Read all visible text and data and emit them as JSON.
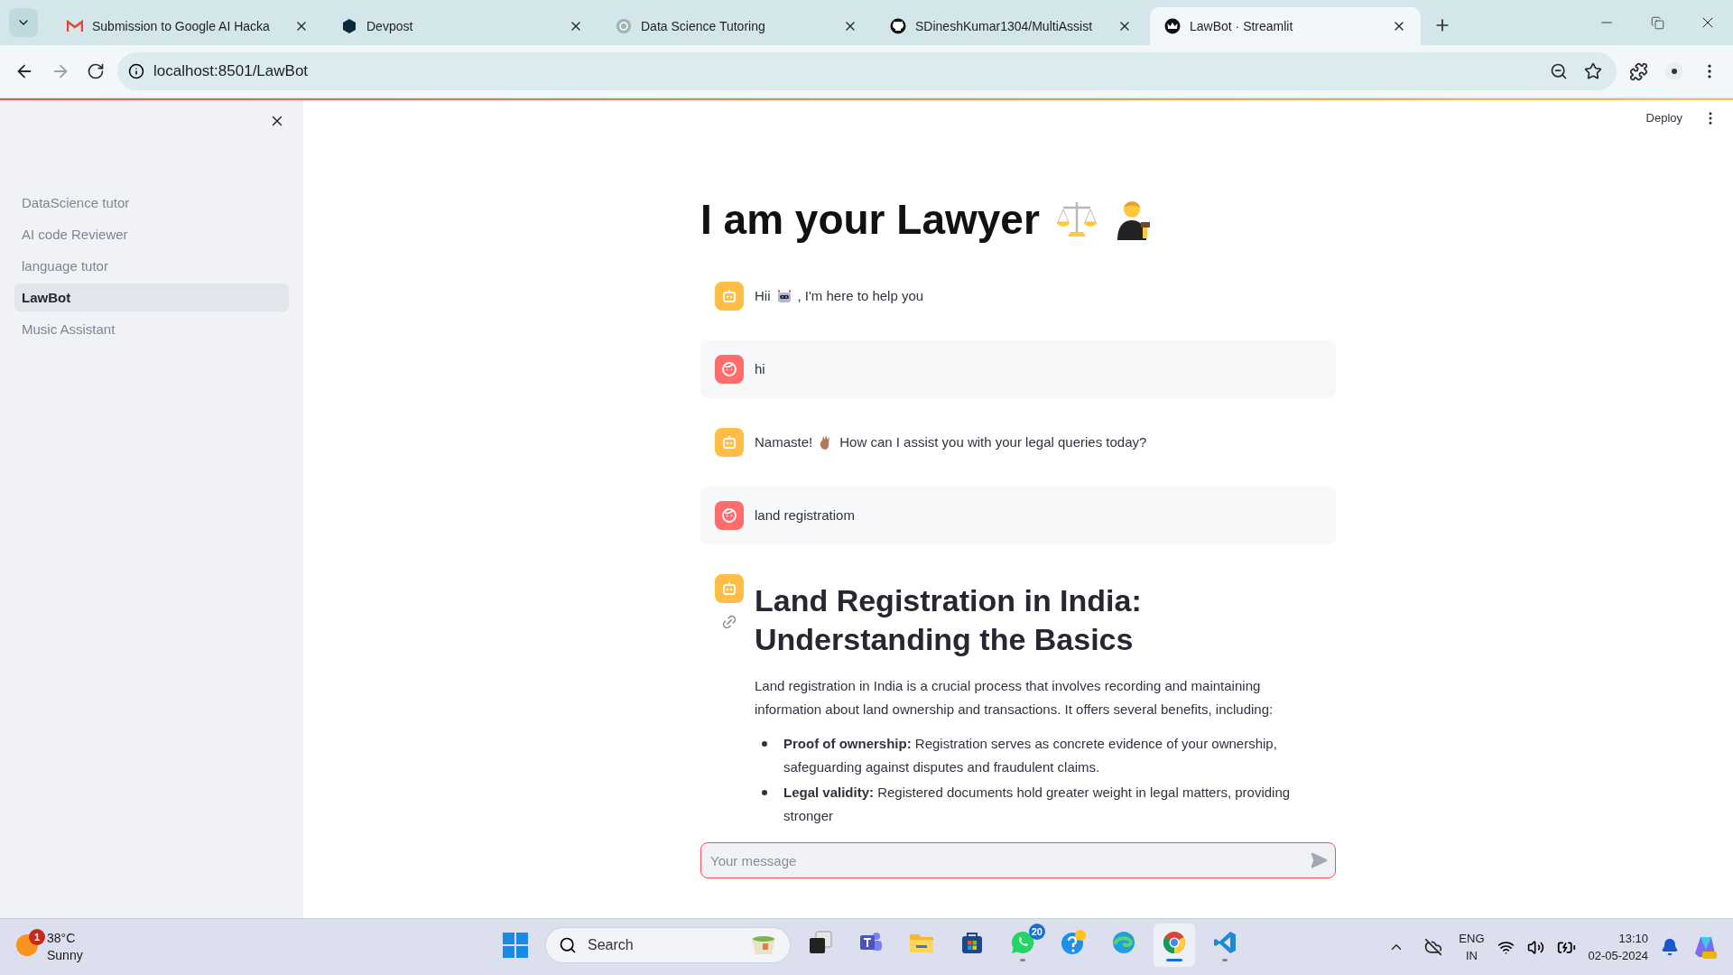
{
  "browser": {
    "tabs": [
      {
        "title": "Submission to Google AI Hacka",
        "kind": "mail",
        "selected": false
      },
      {
        "title": "Devpost",
        "kind": "hexagon",
        "selected": false
      },
      {
        "title": "Data Science Tutoring",
        "kind": "knot",
        "selected": false
      },
      {
        "title": "SDineshKumar1304/MultiAssist",
        "kind": "cat",
        "selected": false
      },
      {
        "title": "LawBot · Streamlit",
        "kind": "crown",
        "selected": true
      }
    ],
    "url": "localhost:8501/LawBot"
  },
  "header": {
    "deploy": "Deploy"
  },
  "sidebar": {
    "items": [
      {
        "label": "DataScience tutor",
        "selected": false
      },
      {
        "label": "AI code Reviewer",
        "selected": false
      },
      {
        "label": "language tutor",
        "selected": false
      },
      {
        "label": "LawBot",
        "selected": true
      },
      {
        "label": "Music Assistant",
        "selected": false
      }
    ]
  },
  "title": "I am your Lawyer",
  "messages": [
    {
      "from_user": false,
      "kind": "text",
      "parts": [
        "Hii",
        ", I'm here to help you"
      ]
    },
    {
      "from_user": true,
      "kind": "text",
      "parts": [
        "hi"
      ]
    },
    {
      "from_user": false,
      "kind": "text",
      "parts": [
        "Namaste!",
        "How can I assist you with your legal queries today?"
      ]
    },
    {
      "from_user": true,
      "kind": "text",
      "parts": [
        "land registratiom"
      ]
    },
    {
      "from_user": false,
      "kind": "article",
      "heading": "Land Registration in India: Understanding the Basics",
      "paragraph": "Land registration in India is a crucial process that involves recording and maintaining information about land ownership and transactions. It offers several benefits, including:",
      "bullets": [
        "**Proof of ownership:** Registration serves as concrete evidence of your ownership, safeguarding against disputes and fraudulent claims.",
        "**Legal validity:** Registered documents hold greater weight in legal matters, providing stronger"
      ]
    }
  ],
  "chat_input": {
    "placeholder": "Your message"
  },
  "taskbar": {
    "weather": {
      "temperature": "38°C",
      "condition": "Sunny",
      "badge": "1"
    },
    "search": {
      "placeholder": "Search"
    },
    "apps": [
      {
        "kind": "task-view",
        "running": false,
        "active": false
      },
      {
        "kind": "meeting",
        "running": false,
        "active": false
      },
      {
        "kind": "folder",
        "running": false,
        "active": false
      },
      {
        "kind": "store",
        "running": false,
        "active": false
      },
      {
        "kind": "messenger",
        "running": true,
        "active": false,
        "badge": "20"
      },
      {
        "kind": "help",
        "running": false,
        "active": false
      },
      {
        "kind": "wave-browser",
        "running": false,
        "active": false
      },
      {
        "kind": "ring-browser",
        "running": true,
        "active": true
      },
      {
        "kind": "editor",
        "running": true,
        "active": false
      }
    ],
    "language": [
      "ENG",
      "IN"
    ],
    "clock": {
      "time": "13:10",
      "date": "02-05-2024"
    }
  }
}
